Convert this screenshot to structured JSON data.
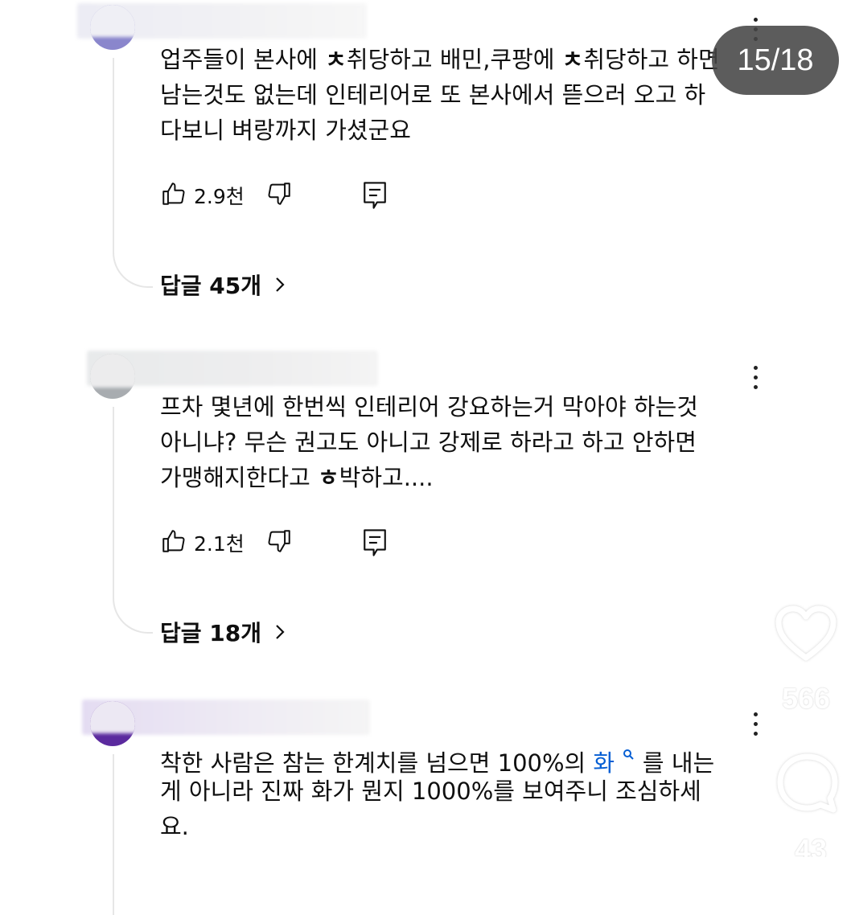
{
  "page_badge": "15/18",
  "comments": [
    {
      "lines": [
        [
          "업주들이 본사에 ",
          "ㅊ",
          "취당하고 배민,쿠팡에 ",
          "ㅊ",
          "취당하고 하면"
        ],
        [
          "남는것도 없는데 인테리어로 또 본사에서 뜯으러 오고 하"
        ],
        [
          "다보니 벼랑까지 가셨군요"
        ]
      ],
      "likes": "2.9천",
      "replies": "답글 45개"
    },
    {
      "lines": [
        [
          "프차 몇년에 한번씩 인테리어 강요하는거 막아야 하는것"
        ],
        [
          "아니냐? 무슨 권고도 아니고 강제로 하라고 하고 안하면"
        ],
        [
          "가맹해지한다고 ",
          "ㅎ",
          "박하고...."
        ]
      ],
      "likes": "2.1천",
      "replies": "답글 18개"
    },
    {
      "lines": [
        [
          "착한 사람은 참는 한계치를 넘으면 100%의 ",
          "화",
          "를 내는"
        ],
        [
          "게 아니라 진짜 화가 뭔지 1000%를 보여주니 조심하세"
        ],
        [
          "요."
        ]
      ]
    }
  ],
  "side": {
    "like_count": "566",
    "comment_count": "43"
  },
  "colors": {
    "avatar_1": "#8a86cc",
    "avatar_2": "#a8acb0",
    "avatar_3": "#5b2a9e",
    "link": "#065fd4",
    "badge_bg": "#464646"
  },
  "icons": {
    "like": "thumbs-up-icon",
    "dislike": "thumbs-down-icon",
    "reply": "reply-icon",
    "more": "more-vert-icon",
    "heart": "heart-icon",
    "chat": "comment-bubble-icon",
    "search": "search-icon"
  }
}
